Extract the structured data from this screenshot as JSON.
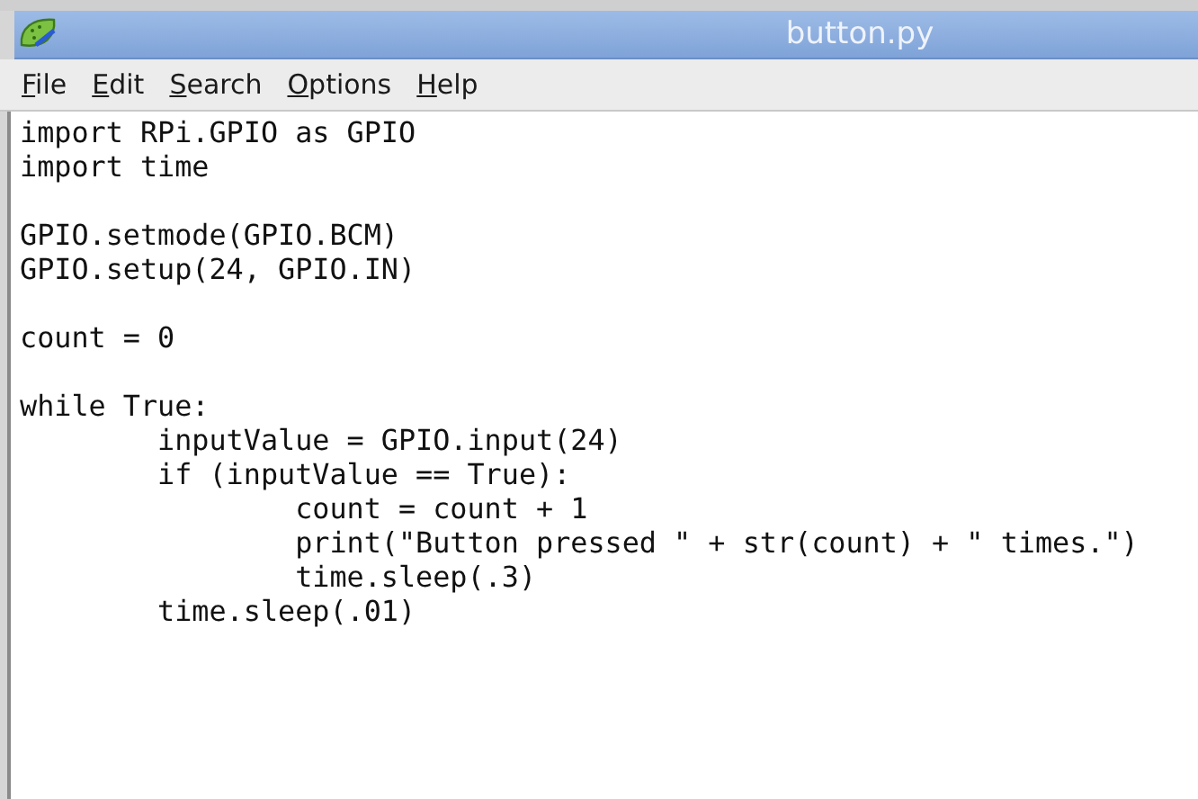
{
  "window": {
    "title": "button.py"
  },
  "menu": [
    "File",
    "Edit",
    "Search",
    "Options",
    "Help"
  ],
  "code_blocks": [
    [
      "import RPi.GPIO as GPIO",
      "import time"
    ],
    [
      "GPIO.setmode(GPIO.BCM)",
      "GPIO.setup(24, GPIO.IN)"
    ],
    [
      "count = 0"
    ],
    [
      "while True:",
      "        inputValue = GPIO.input(24)",
      "        if (inputValue == True):",
      "                count = count + 1",
      "                print(\"Button pressed \" + str(count) + \" times.\")",
      "                time.sleep(.3)",
      "        time.sleep(.01)"
    ]
  ]
}
